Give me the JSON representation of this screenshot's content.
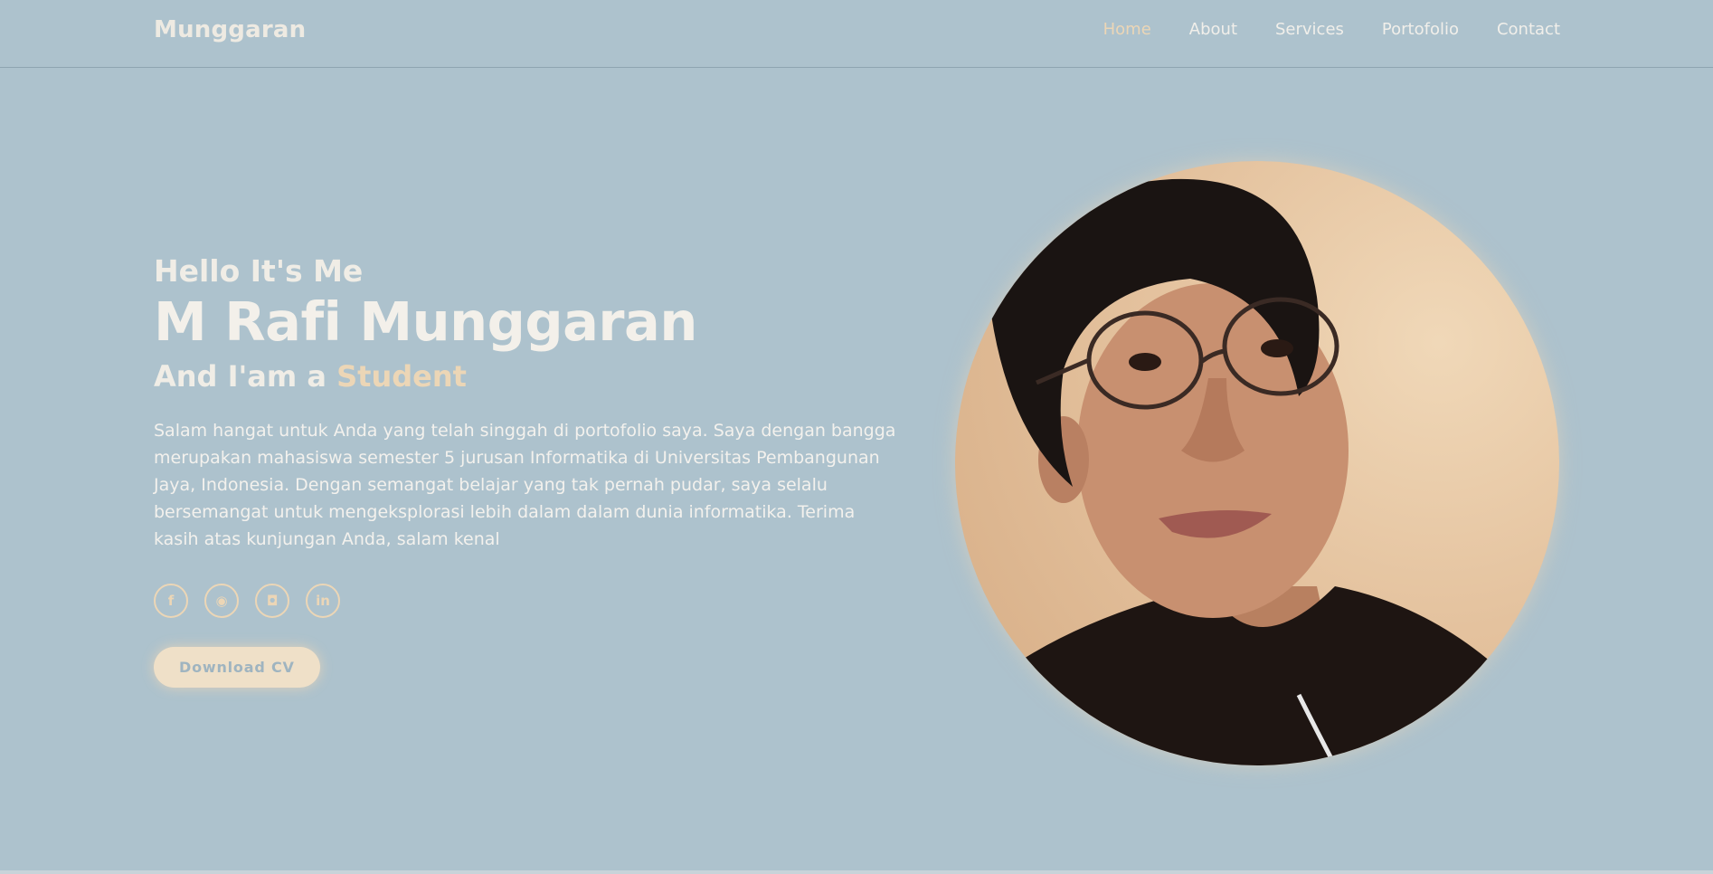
{
  "header": {
    "logo": "Munggaran",
    "nav": [
      {
        "label": "Home",
        "active": true
      },
      {
        "label": "About",
        "active": false
      },
      {
        "label": "Services",
        "active": false
      },
      {
        "label": "Portofolio",
        "active": false
      },
      {
        "label": "Contact",
        "active": false
      }
    ]
  },
  "hero": {
    "greeting": "Hello It's Me",
    "name": "M Rafi Munggaran",
    "role_prefix": "And I'am a",
    "role": "Student",
    "description": "Salam hangat untuk Anda yang telah singgah di portofolio saya. Saya dengan bangga merupakan mahasiswa semester 5 jurusan Informatika di Universitas Pembangunan Jaya, Indonesia. Dengan semangat belajar yang tak pernah pudar, saya selalu bersemangat untuk mengeksplorasi lebih dalam dalam dunia informatika. Terima kasih atas kunjungan Anda, salam kenal",
    "socials": [
      {
        "icon": "facebook-icon",
        "glyph": "f"
      },
      {
        "icon": "github-icon",
        "glyph": "◉"
      },
      {
        "icon": "instagram-icon",
        "glyph": "◘"
      },
      {
        "icon": "linkedin-icon",
        "glyph": "in"
      }
    ],
    "cv_button": "Download CV"
  },
  "colors": {
    "background": "#adc2cd",
    "accent": "#ecd6b6",
    "text": "#eeeae2"
  }
}
